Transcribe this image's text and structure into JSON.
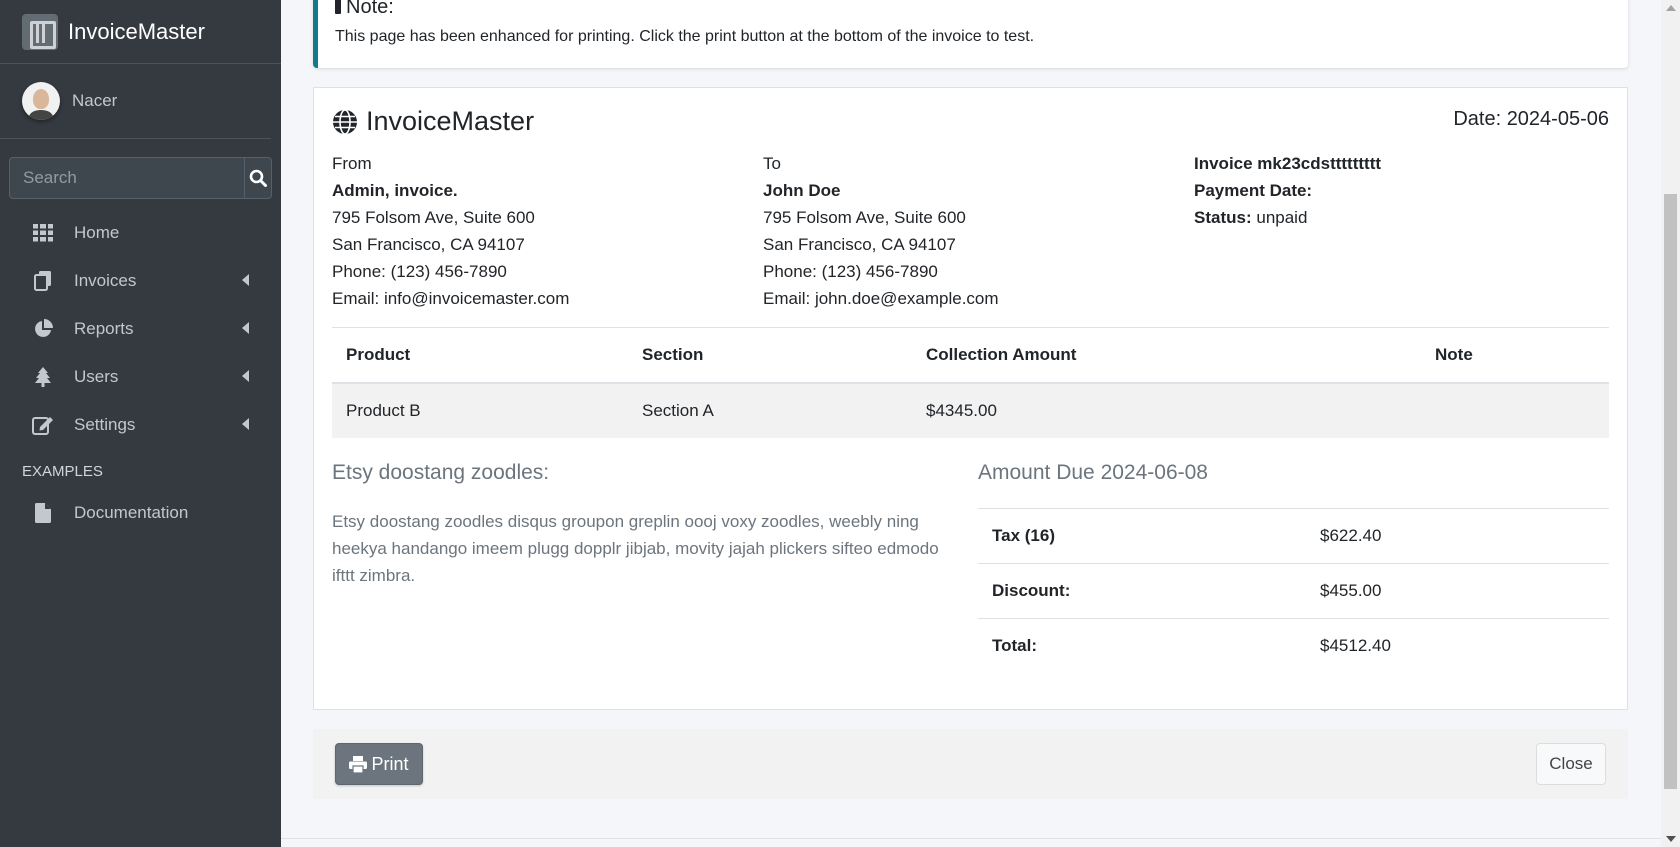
{
  "brand": {
    "name_bold": "Invoice",
    "name_light": "Master"
  },
  "user": {
    "name": "Nacer"
  },
  "search": {
    "placeholder": "Search"
  },
  "nav": {
    "items": [
      {
        "label": "Home",
        "icon": "grid-icon",
        "has_arrow": false
      },
      {
        "label": "Invoices",
        "icon": "files-icon",
        "has_arrow": true
      },
      {
        "label": "Reports",
        "icon": "pie-chart-icon",
        "has_arrow": true
      },
      {
        "label": "Users",
        "icon": "tree-icon",
        "has_arrow": true
      },
      {
        "label": "Settings",
        "icon": "edit-icon",
        "has_arrow": true
      }
    ],
    "section_header": "EXAMPLES",
    "docs_label": "Documentation"
  },
  "note": {
    "title": "Note:",
    "text": "This page has been enhanced for printing. Click the print button at the bottom of the invoice to test."
  },
  "invoice": {
    "title": "InvoiceMaster",
    "date": "Date: 2024-05-06",
    "from": {
      "label": "From",
      "name": "Admin, invoice.",
      "address1": "795 Folsom Ave, Suite 600",
      "address2": "San Francisco, CA 94107",
      "phone": "Phone: (123) 456-7890",
      "email": "Email: info@invoicemaster.com"
    },
    "to": {
      "label": "To",
      "name": "John Doe",
      "address1": "795 Folsom Ave, Suite 600",
      "address2": "San Francisco, CA 94107",
      "phone": "Phone: (123) 456-7890",
      "email": "Email: john.doe@example.com"
    },
    "meta": {
      "invoice_label": "Invoice mk23cdsttttttttt",
      "payment_date_label": "Payment Date:",
      "status_label": "Status:",
      "status_value": "unpaid"
    },
    "table": {
      "headers": [
        "Product",
        "Section",
        "Collection Amount",
        "Note"
      ],
      "rows": [
        [
          "Product B",
          "Section A",
          "$4345.00",
          ""
        ]
      ]
    },
    "notes_title": "Etsy doostang zoodles:",
    "notes_text": "Etsy doostang zoodles disqus groupon greplin oooj voxy zoodles, weebly ning heekya handango imeem plugg dopplr jibjab, movity jajah plickers sifteo edmodo ifttt zimbra.",
    "amount_due": "Amount Due 2024-06-08",
    "summary": [
      {
        "label": "Tax (16)",
        "value": "$622.40"
      },
      {
        "label": "Discount:",
        "value": "$455.00"
      },
      {
        "label": "Total:",
        "value": "$4512.40"
      }
    ]
  },
  "actions": {
    "print_label": "Print",
    "close_label": "Close"
  },
  "colors": {
    "sidebar_bg": "#343a40",
    "callout_border": "#117a8b",
    "print_btn": "#6c757d"
  }
}
